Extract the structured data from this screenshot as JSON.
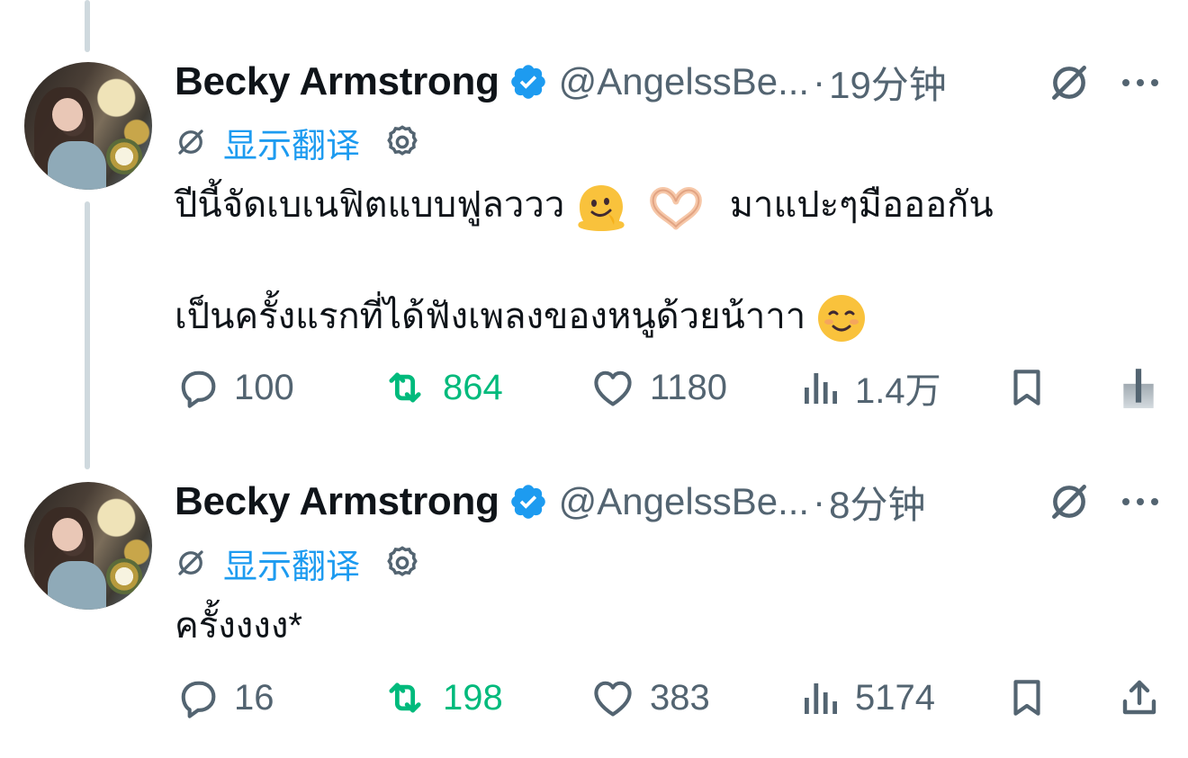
{
  "tweets": [
    {
      "author_name": "Becky Armstrong",
      "handle": "@AngelssBe...",
      "separator": "·",
      "time": "19分钟",
      "translate_label": "显示翻译",
      "text_line1_a": "ปีนี้จัดเบเนฟิตแบบฟูลววว",
      "text_line1_b": "มาแปะๆมือออกัน",
      "text_line2": "เป็นครั้งแรกที่ได้ฟังเพลงของหนูด้วยน้าาา",
      "replies": "100",
      "retweets": "864",
      "likes": "1180",
      "views": "1.4万"
    },
    {
      "author_name": "Becky Armstrong",
      "handle": "@AngelssBe...",
      "separator": "·",
      "time": "8分钟",
      "translate_label": "显示翻译",
      "text_line1": "ครั้งงงง*",
      "replies": "16",
      "retweets": "198",
      "likes": "383",
      "views": "5174"
    }
  ],
  "colors": {
    "text_primary": "#0f1419",
    "text_secondary": "#536471",
    "accent_blue": "#1d9bf0",
    "retweet_green": "#00ba7c",
    "thread_line": "#cfd9de"
  },
  "icons": [
    "verified-badge-icon",
    "grok-icon",
    "more-icon",
    "translate-icon",
    "gear-icon",
    "reply-icon",
    "retweet-icon",
    "like-icon",
    "views-icon",
    "bookmark-icon",
    "share-icon",
    "melting-face-emoji",
    "heart-hands-emoji",
    "smiling-face-emoji"
  ]
}
